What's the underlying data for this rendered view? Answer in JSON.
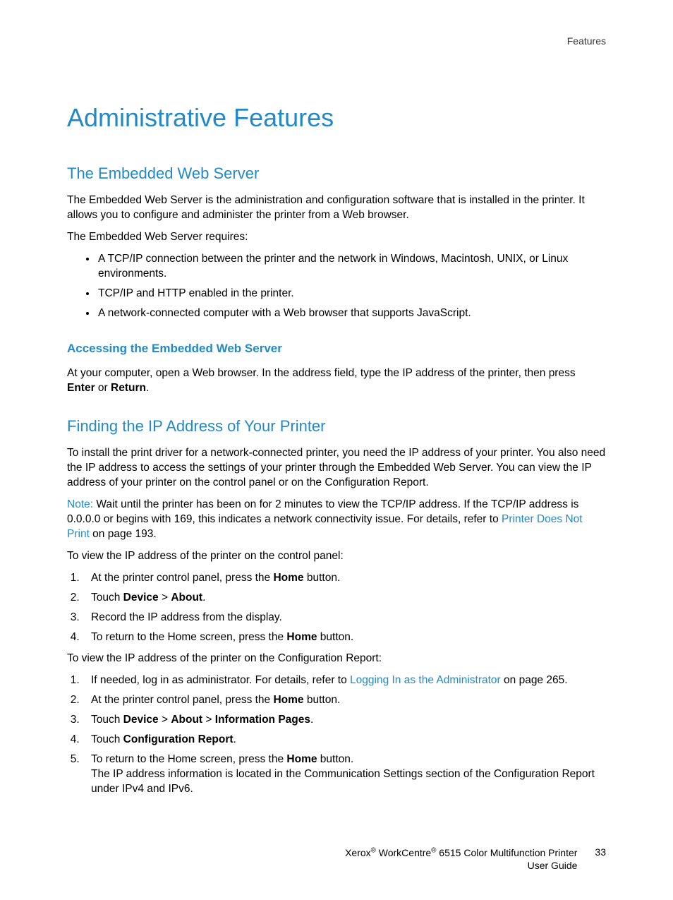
{
  "header": {
    "section": "Features"
  },
  "title": "Administrative Features",
  "s1": {
    "heading": "The Embedded Web Server",
    "p1": "The Embedded Web Server is the administration and configuration software that is installed in the printer. It allows you to configure and administer the printer from a Web browser.",
    "p2": "The Embedded Web Server requires:",
    "b1": "A TCP/IP connection between the printer and the network in Windows, Macintosh, UNIX, or Linux environments.",
    "b2": "TCP/IP and HTTP enabled in the printer.",
    "b3": "A network-connected computer with a Web browser that supports JavaScript."
  },
  "s2": {
    "heading": "Accessing the Embedded Web Server",
    "p1a": "At your computer, open a Web browser. In the address field, type the IP address of the printer, then press ",
    "p1b": "Enter",
    "p1c": " or ",
    "p1d": "Return",
    "p1e": "."
  },
  "s3": {
    "heading": "Finding the IP Address of Your Printer",
    "p1": "To install the print driver for a network-connected printer, you need the IP address of your printer. You also need the IP address to access the settings of your printer through the Embedded Web Server. You can view the IP address of your printer on the control panel or on the Configuration Report.",
    "note_label": "Note:",
    "note_a": " Wait until the printer has been on for 2 minutes to view the TCP/IP address. If the TCP/IP address is 0.0.0.0 or begins with 169, this indicates a network connectivity issue. For details, refer to ",
    "note_link": "Printer Does Not Print",
    "note_b": " on page 193.",
    "p2": "To view the IP address of the printer on the control panel:",
    "l1a": "At the printer control panel, press the ",
    "l1b": "Home",
    "l1c": " button.",
    "l2a": "Touch ",
    "l2b": "Device",
    "l2c": " > ",
    "l2d": "About",
    "l2e": ".",
    "l3": "Record the IP address from the display.",
    "l4a": "To return to the Home screen, press the ",
    "l4b": "Home",
    "l4c": " button.",
    "p3": "To view the IP address of the printer on the Configuration Report:",
    "m1a": "If needed, log in as administrator. For details, refer to ",
    "m1link": "Logging In as the Administrator",
    "m1b": " on page 265.",
    "m2a": "At the printer control panel, press the ",
    "m2b": "Home",
    "m2c": " button.",
    "m3a": "Touch ",
    "m3b": "Device",
    "m3c": " > ",
    "m3d": "About",
    "m3e": " > ",
    "m3f": "Information Pages",
    "m3g": ".",
    "m4a": "Touch ",
    "m4b": "Configuration Report",
    "m4c": ".",
    "m5a": "To return to the Home screen, press the ",
    "m5b": "Home",
    "m5c": " button.",
    "m5d": "The IP address information is located in the Communication Settings section of the Configuration Report under IPv4 and IPv6."
  },
  "footer": {
    "line1a": "Xerox",
    "line1b": " WorkCentre",
    "line1c": " 6515 Color Multifunction Printer",
    "line2": "User Guide",
    "page": "33"
  }
}
